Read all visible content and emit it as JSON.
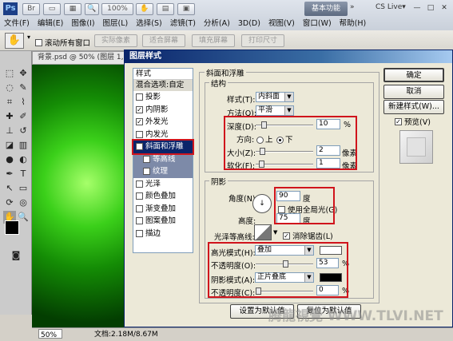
{
  "app": {
    "workspace": "基本功能",
    "cslive": "CS Live▾",
    "zoom_menu": "100%"
  },
  "menu": [
    "文件(F)",
    "编辑(E)",
    "图像(I)",
    "图层(L)",
    "选择(S)",
    "滤镜(T)",
    "分析(A)",
    "3D(D)",
    "视图(V)",
    "窗口(W)",
    "帮助(H)"
  ],
  "options": {
    "scroll_all": "滚动所有窗口",
    "actual_pixels": "实际像素",
    "fit_screen": "适合屏幕",
    "fill_screen": "填充屏幕",
    "print_size": "打印尺寸"
  },
  "document": {
    "tab": "背景.psd @ 50% (图层 1, ",
    "zoom": "50%",
    "doc_size": "文档:2.18M/8.67M"
  },
  "dialog": {
    "title": "图层样式",
    "styles_header": "样式",
    "blend_options": "混合选项:自定",
    "style_items": [
      {
        "label": "投影",
        "checked": false,
        "kind": "normal"
      },
      {
        "label": "内阴影",
        "checked": true,
        "kind": "normal"
      },
      {
        "label": "外发光",
        "checked": true,
        "kind": "normal"
      },
      {
        "label": "内发光",
        "checked": false,
        "kind": "normal"
      },
      {
        "label": "斜面和浮雕",
        "checked": true,
        "kind": "selected"
      },
      {
        "label": "等高线",
        "checked": false,
        "kind": "sub"
      },
      {
        "label": "纹理",
        "checked": false,
        "kind": "sub"
      },
      {
        "label": "光泽",
        "checked": false,
        "kind": "normal"
      },
      {
        "label": "颜色叠加",
        "checked": false,
        "kind": "normal"
      },
      {
        "label": "渐变叠加",
        "checked": false,
        "kind": "normal"
      },
      {
        "label": "图案叠加",
        "checked": false,
        "kind": "normal"
      },
      {
        "label": "描边",
        "checked": false,
        "kind": "normal"
      }
    ],
    "section_title": "斜面和浮雕",
    "structure": {
      "group": "结构",
      "style_label": "样式(T):",
      "style_value": "内斜面",
      "technique_label": "方法(Q):",
      "technique_value": "平滑",
      "depth_label": "深度(D):",
      "depth_value": "10",
      "depth_unit": "%",
      "depth_pct": 10,
      "direction_label": "方向:",
      "dir_up": "上",
      "dir_down": "下",
      "size_label": "大小(Z):",
      "size_value": "2",
      "size_unit": "像素",
      "size_pct": 8,
      "soften_label": "软化(F):",
      "soften_value": "1",
      "soften_unit": "像素",
      "soften_pct": 6
    },
    "shading": {
      "group": "阴影",
      "angle_label": "角度(N):",
      "angle_value": "90",
      "angle_unit": "度",
      "global_light": "使用全局光(G)",
      "altitude_label": "高度:",
      "altitude_value": "75",
      "altitude_unit": "度",
      "gloss_label": "光泽等高线:",
      "anti_alias": "消除锯齿(L)",
      "highlight_label": "高光模式(H):",
      "highlight_mode": "叠加",
      "highlight_color": "#ffffff",
      "opacity1_label": "不透明度(O):",
      "opacity1_value": "53",
      "opacity1_pct": 53,
      "shadow_label": "阴影模式(A):",
      "shadow_mode": "正片叠底",
      "shadow_color": "#000000",
      "opacity2_label": "不透明度(C):",
      "opacity2_value": "0",
      "opacity2_pct": 0,
      "pct": "%"
    },
    "make_default": "设置为默认值",
    "reset_default": "复位为默认值",
    "ok": "确定",
    "cancel": "取消",
    "new_style": "新建样式(W)...",
    "preview": "预览(V)"
  },
  "watermark": "腾龍視覺 WWW.TLVI.NET"
}
